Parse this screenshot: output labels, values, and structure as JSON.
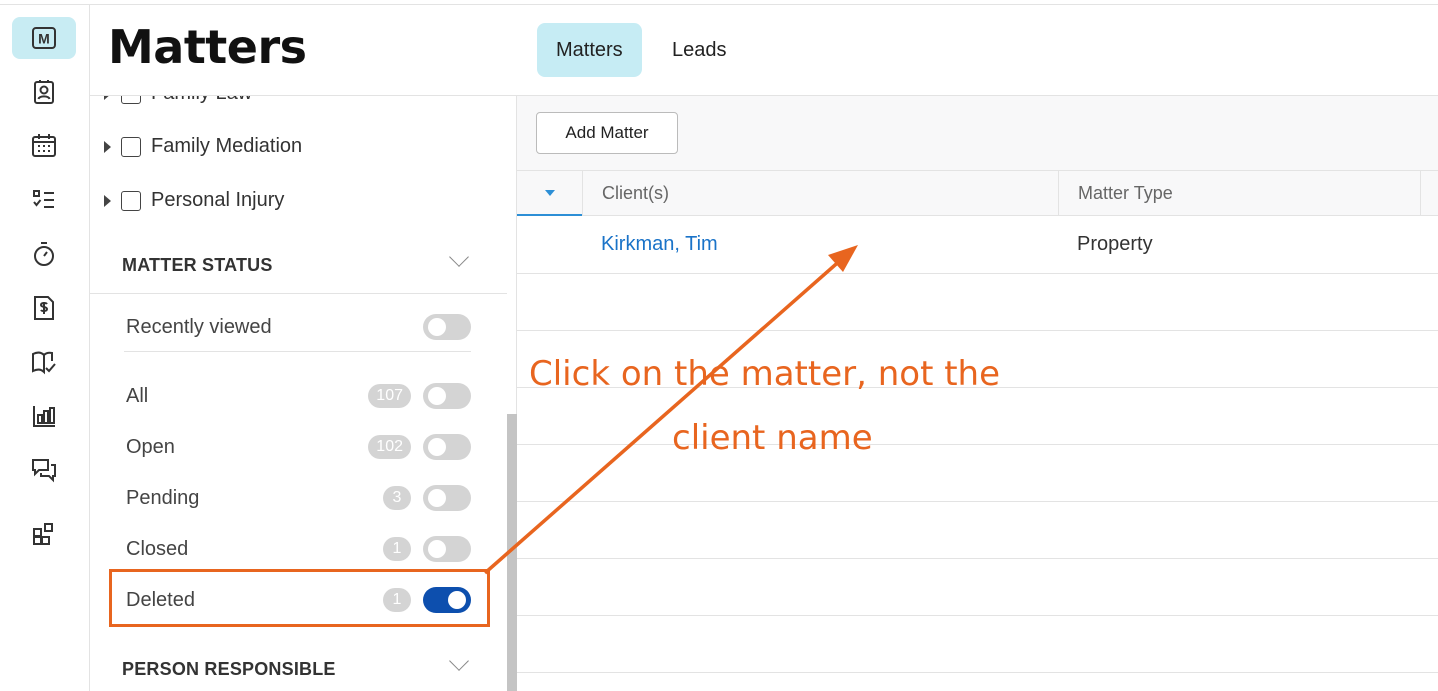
{
  "page": {
    "title": "Matters",
    "tabs": [
      {
        "label": "Matters",
        "active": true
      },
      {
        "label": "Leads",
        "active": false
      }
    ]
  },
  "rail": {
    "items": [
      {
        "icon": "matters-icon",
        "label": "M",
        "active": true
      },
      {
        "icon": "contacts-icon"
      },
      {
        "icon": "calendar-icon"
      },
      {
        "icon": "tasks-icon"
      },
      {
        "icon": "timer-icon"
      },
      {
        "icon": "billing-icon"
      },
      {
        "icon": "documents-icon"
      },
      {
        "icon": "reports-icon"
      },
      {
        "icon": "messages-icon"
      },
      {
        "icon": "apps-icon"
      }
    ]
  },
  "filters": {
    "practice_areas": [
      {
        "label": "Family Law",
        "checked": false
      },
      {
        "label": "Family Mediation",
        "checked": false
      },
      {
        "label": "Personal Injury",
        "checked": false
      }
    ],
    "matter_status": {
      "heading": "MATTER STATUS",
      "recently_viewed": {
        "label": "Recently viewed",
        "on": false
      },
      "items": [
        {
          "label": "All",
          "count": "107",
          "on": false
        },
        {
          "label": "Open",
          "count": "102",
          "on": false
        },
        {
          "label": "Pending",
          "count": "3",
          "on": false
        },
        {
          "label": "Closed",
          "count": "1",
          "on": false
        },
        {
          "label": "Deleted",
          "count": "1",
          "on": true
        }
      ]
    },
    "person_responsible": {
      "heading": "PERSON RESPONSIBLE"
    }
  },
  "main": {
    "add_button": "Add Matter",
    "columns": [
      "Client(s)",
      "Matter Type"
    ],
    "rows": [
      {
        "client": "Kirkman, Tim",
        "matter_type": "Property"
      }
    ]
  },
  "annotation": {
    "line1": "Click on the matter, not the",
    "line2": "client name",
    "color": "#e8651f"
  },
  "colors": {
    "accent": "#c6ecf4",
    "toggle_on": "#0d4fae",
    "link": "#1a73c8",
    "highlight": "#e8651f"
  }
}
